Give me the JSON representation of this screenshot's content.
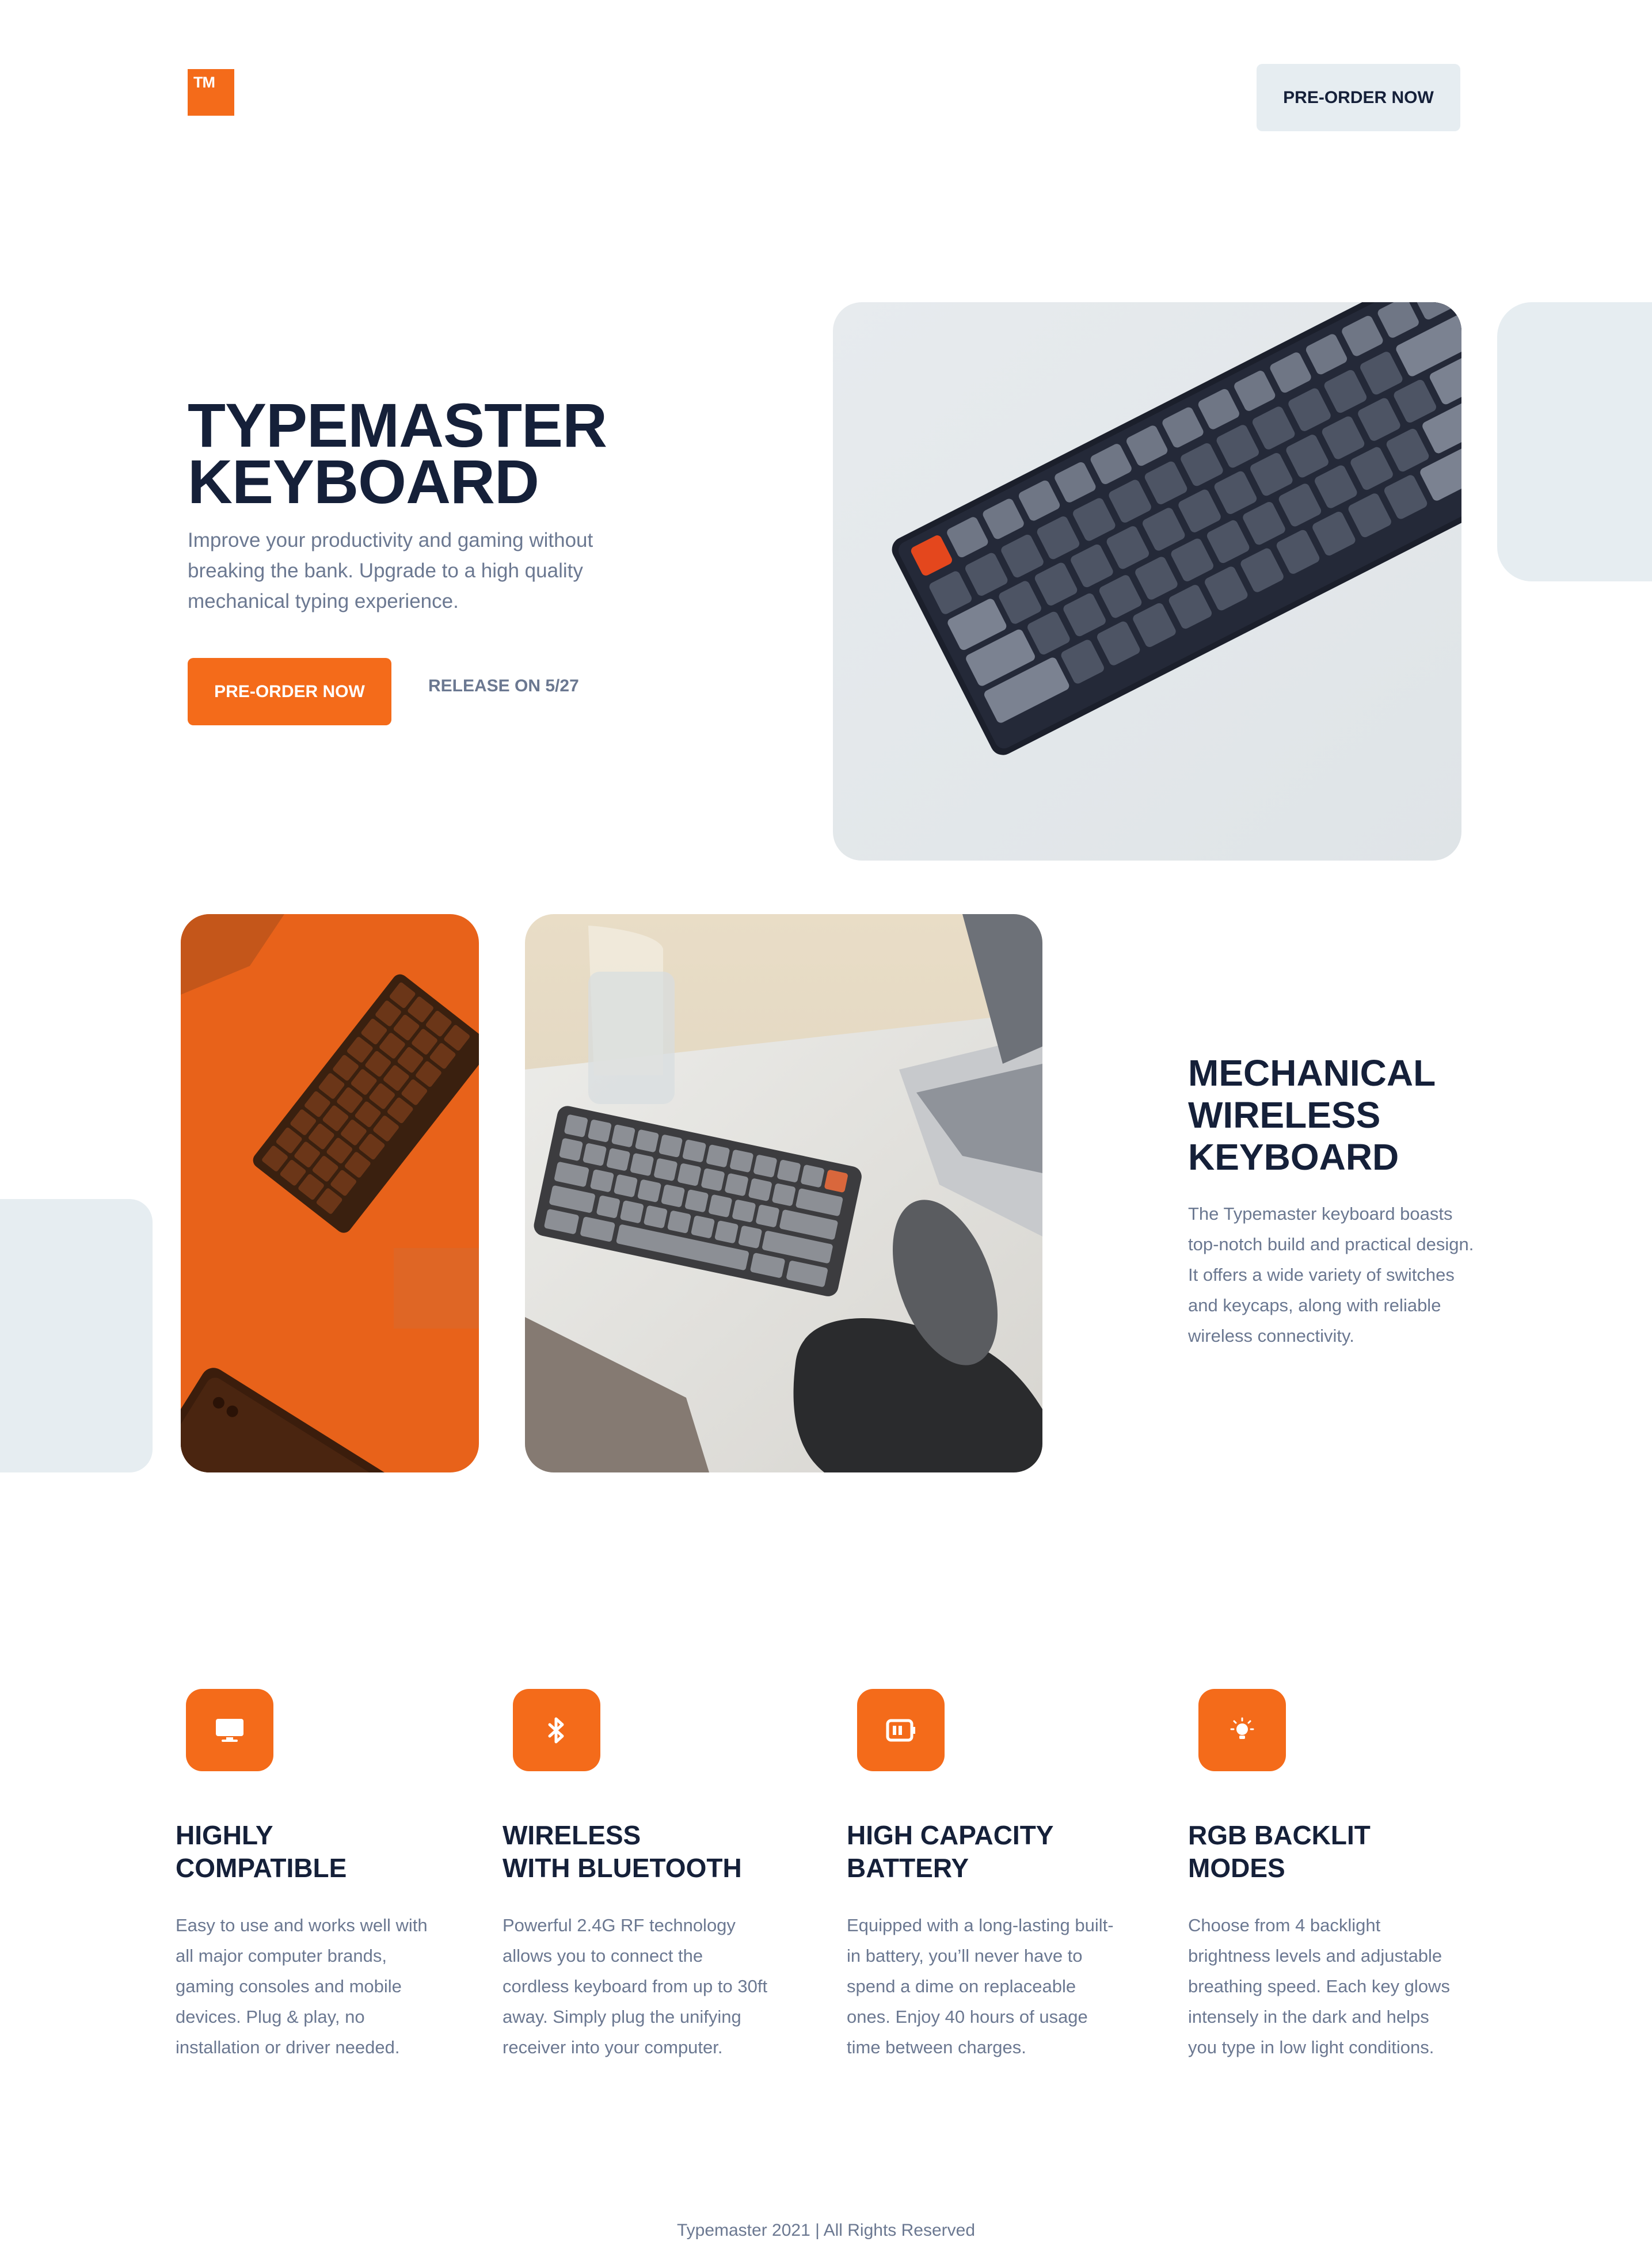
{
  "header": {
    "logo_text": "TM",
    "cta_label": "PRE-ORDER NOW"
  },
  "hero": {
    "title_line1": "TYPEMASTER",
    "title_line2": "KEYBOARD",
    "subtitle": "Improve your productivity and gaming without breaking the bank. Upgrade to a high quality mechanical typing experience.",
    "cta_label": "PRE-ORDER NOW",
    "release_text": "RELEASE ON 5/27"
  },
  "mechanical": {
    "title_line1": "MECHANICAL",
    "title_line2": "WIRELESS",
    "title_line3": "KEYBOARD",
    "body": "The Typemaster keyboard boasts top-notch build and practical design. It offers a wide variety of switches and keycaps, along with reliable wireless connectivity."
  },
  "features": [
    {
      "icon": "monitor-icon",
      "title_line1": "HIGHLY",
      "title_line2": "COMPATIBLE",
      "body": "Easy to use and works well with all major computer brands, gaming consoles and mobile devices. Plug & play, no installation or driver needed."
    },
    {
      "icon": "bluetooth-icon",
      "title_line1": "WIRELESS",
      "title_line2": "WITH BLUETOOTH",
      "body": "Powerful 2.4G RF technology allows you to connect the cordless keyboard from up to 30ft away. Simply plug the unifying receiver into your computer."
    },
    {
      "icon": "battery-icon",
      "title_line1": "HIGH CAPACITY",
      "title_line2": "BATTERY",
      "body": "Equipped with a long-lasting built-in battery, you’ll never have to spend a dime on replaceable ones.  Enjoy 40 hours of usage time between charges."
    },
    {
      "icon": "lightbulb-icon",
      "title_line1": "RGB BACKLIT",
      "title_line2": "MODES",
      "body": "Choose from 4 backlight brightness levels and adjustable breathing speed. Each key glows intensely in the dark and helps you type in low light conditions."
    }
  ],
  "footer": {
    "text": "Typemaster 2021 | All Rights Reserved"
  },
  "colors": {
    "accent": "#f46b1a",
    "heading": "#152039",
    "body_text": "#6b7891",
    "light_panel": "#e6edf1"
  }
}
